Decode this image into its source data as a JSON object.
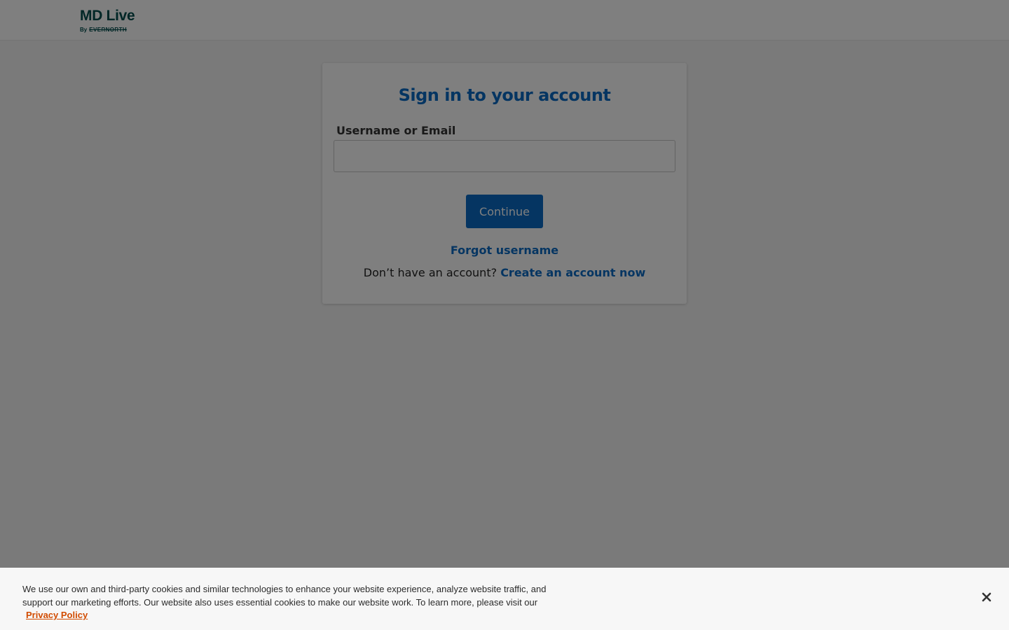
{
  "header": {
    "logo": {
      "main": "MD Live",
      "by": "By",
      "brand": "EVERNORTH"
    }
  },
  "signin": {
    "title": "Sign in to your account",
    "username_label": "Username or Email",
    "username_value": "",
    "username_placeholder": "",
    "continue_label": "Continue",
    "forgot_username": "Forgot username",
    "no_account_text": "Don’t have an account?",
    "create_account_link": "Create an account now"
  },
  "cookie_banner": {
    "text": "We use our own and third-party cookies and similar technologies to enhance your website experience, analyze website traffic, and support our marketing efforts. Our website also uses essential cookies to make our website work. To learn more, please visit our",
    "privacy_link": "Privacy Policy",
    "close_icon": "close-icon"
  },
  "colors": {
    "brand_teal": "#004d4d",
    "primary_blue": "#0a6bc4",
    "privacy_orange": "#d14b00",
    "overlay": "rgba(0,0,0,0.5)"
  }
}
